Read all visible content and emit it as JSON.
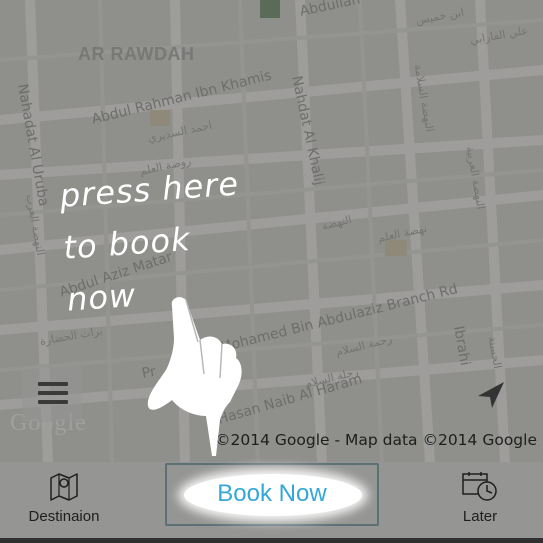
{
  "map": {
    "district": "AR RAWDAH",
    "streets": {
      "s1": "Abdul Rahman Ibn Khamis",
      "s2": "Nahadat Al Uruba",
      "s3": "Nahdat Al Khalij",
      "s4": "Abdullah",
      "s5": "Abdul Aziz Matar",
      "s6": "Mohamed Bin Abdulaziz Branch Rd",
      "s7": "Pr",
      "s8": "Hasan Naib Al Haram",
      "s9": "Ibrahi"
    },
    "arabic_labels": {
      "a1": "علي الفارابي",
      "a2": "ابن خميس",
      "a3": "النهضة السلامة",
      "a4": "احمد السديري",
      "a5": "روضة العلم",
      "a6": "النهضة العربية",
      "a7": "النهضة",
      "a8": "نهضة العلم",
      "a9": "رحمة السلام",
      "a10": "براث الحضارة",
      "a11": "رحلة السلام",
      "a12": "النهضة العرب",
      "a13": "الحسنة"
    },
    "copyright": "©2014 Google - Map data ©2014 Google",
    "watermark": "Google"
  },
  "hint": {
    "text": "press here\nto book\nnow"
  },
  "controls": {
    "menu_icon": "hamburger-menu-icon",
    "location_icon": "navigation-arrow-icon"
  },
  "bottom_bar": {
    "destination_label": "Destinaion",
    "destination_icon": "map-icon",
    "book_label": "Book Now",
    "later_label": "Later",
    "later_icon": "calendar-clock-icon"
  },
  "colors": {
    "book_text": "#33a8d8",
    "bottom_bar": "#959593",
    "map_bg": "#a7a6a3"
  }
}
